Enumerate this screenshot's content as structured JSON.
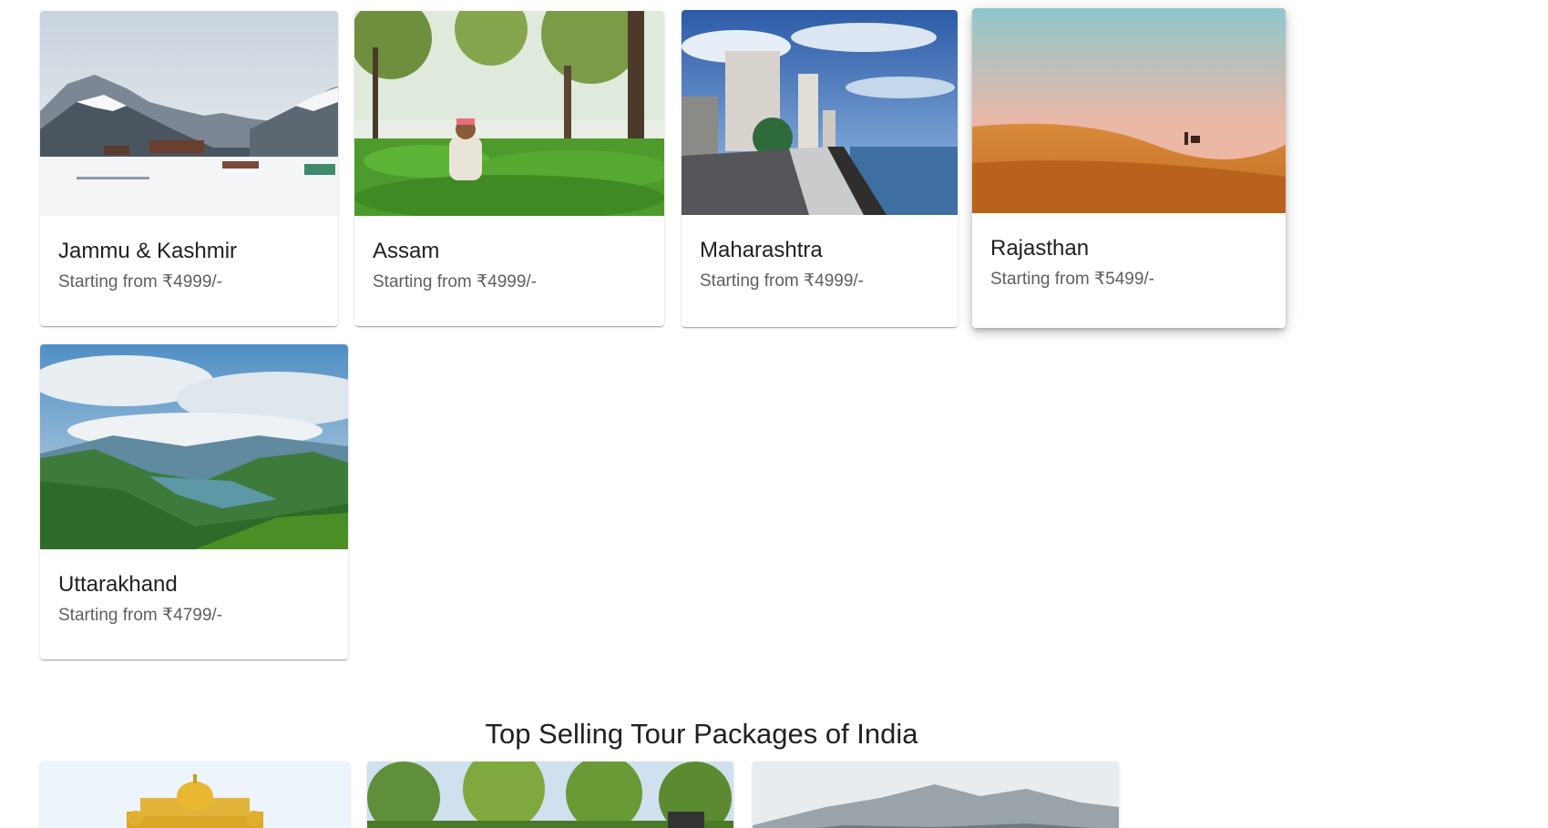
{
  "destinations": [
    {
      "name": "Jammu & Kashmir",
      "price": "Starting from ₹4999/-"
    },
    {
      "name": "Assam",
      "price": "Starting from ₹4999/-"
    },
    {
      "name": "Maharashtra",
      "price": "Starting from ₹4999/-"
    },
    {
      "name": "Rajasthan",
      "price": "Starting from ₹5499/-"
    },
    {
      "name": "Uttarakhand",
      "price": "Starting from ₹4799/-"
    }
  ],
  "top_selling": {
    "heading": "Top Selling Tour Packages of India"
  },
  "colors": {
    "card_background": "#ffffff",
    "title_text": "#212121",
    "price_text": "#5f5f5f"
  }
}
